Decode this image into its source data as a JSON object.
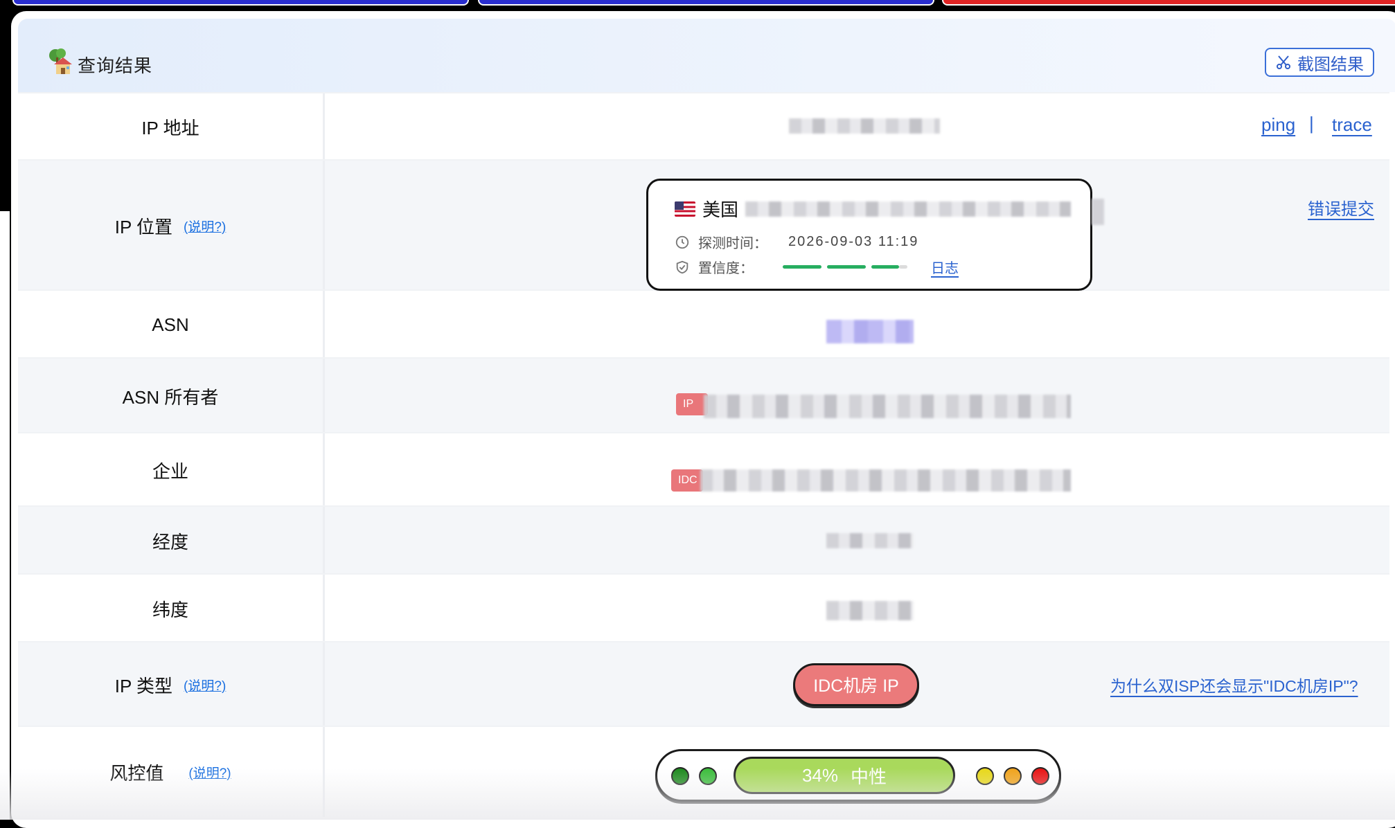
{
  "header": {
    "title": "查询结果",
    "screenshot_button": "截图结果"
  },
  "rows": {
    "ip_address": {
      "label": "IP 地址",
      "ping": "ping",
      "sep": "|",
      "trace": "trace"
    },
    "ip_location": {
      "label": "IP 位置",
      "explain": "(说明?)",
      "country": "美国",
      "detect_label": "探测时间：",
      "detect_time": "2026-09-03 11:19",
      "confidence_label": "置信度：",
      "confidence_level": 0.92,
      "log_link": "日志",
      "error_link": "错误提交"
    },
    "asn": {
      "label": "ASN"
    },
    "asn_owner": {
      "label": "ASN 所有者",
      "tag": "IP"
    },
    "company": {
      "label": "企业",
      "tag": "IDC"
    },
    "longitude": {
      "label": "经度"
    },
    "latitude": {
      "label": "纬度"
    },
    "ip_type": {
      "label": "IP 类型",
      "explain": "(说明?)",
      "badge": "IDC机房 IP",
      "why_link": "为什么双ISP还会显示\"IDC机房IP\"?"
    },
    "risk": {
      "label": "风控值",
      "explain": "(说明?)",
      "percent": "34%",
      "level_text": "中性",
      "colors": [
        "#1f8a1f",
        "#3cbd3c",
        "#e8d81a",
        "#f0a31c",
        "#e81414"
      ]
    }
  }
}
